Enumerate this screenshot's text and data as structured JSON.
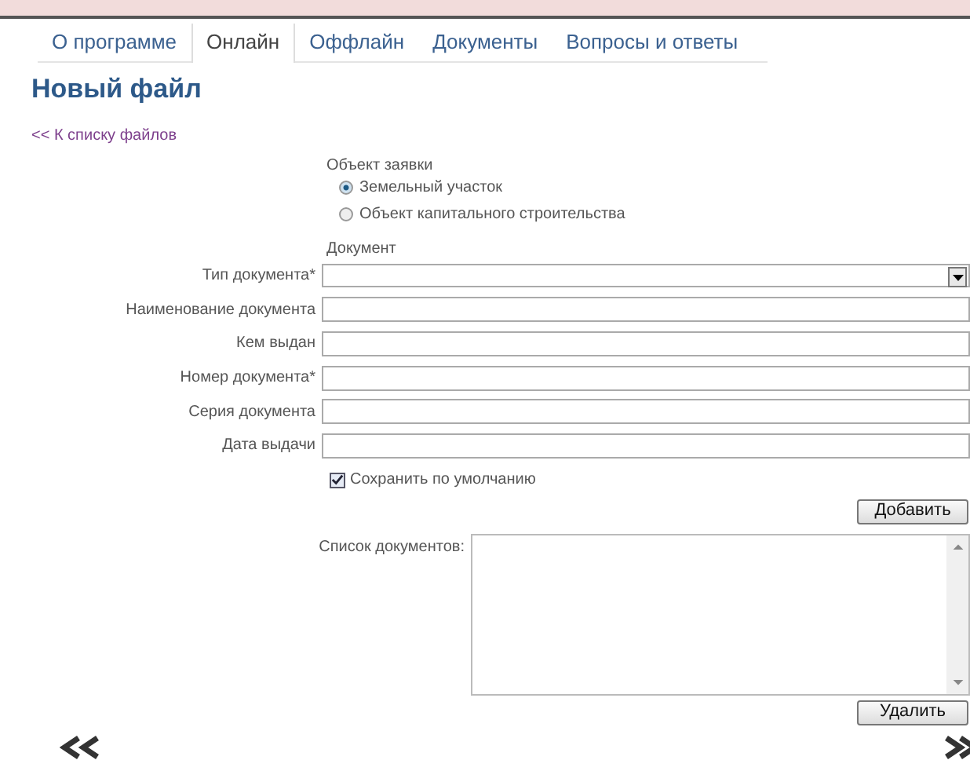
{
  "tabs": [
    {
      "label": "О программе",
      "selected": false
    },
    {
      "label": "Онлайн",
      "selected": true
    },
    {
      "label": "Оффлайн",
      "selected": false
    },
    {
      "label": "Документы",
      "selected": false
    },
    {
      "label": "Вопросы и ответы",
      "selected": false
    }
  ],
  "title": "Новый файл",
  "back_link": "<< К списку файлов",
  "object_group": {
    "label": "Объект заявки",
    "options": [
      {
        "label": "Земельный участок",
        "selected": true
      },
      {
        "label": "Объект капитального строительства",
        "selected": false
      }
    ]
  },
  "document_section": "Документ",
  "fields": [
    {
      "label": "Тип документа*",
      "kind": "select"
    },
    {
      "label": "Наименование документа",
      "kind": "text"
    },
    {
      "label": "Кем выдан",
      "kind": "text"
    },
    {
      "label": "Номер документа*",
      "kind": "text"
    },
    {
      "label": "Серия документа",
      "kind": "text"
    },
    {
      "label": "Дата выдачи",
      "kind": "text"
    }
  ],
  "save_default": {
    "label": "Сохранить по умолчанию",
    "checked": true
  },
  "add_button": "Добавить",
  "list_label": "Список документов:",
  "delete_button": "Удалить"
}
